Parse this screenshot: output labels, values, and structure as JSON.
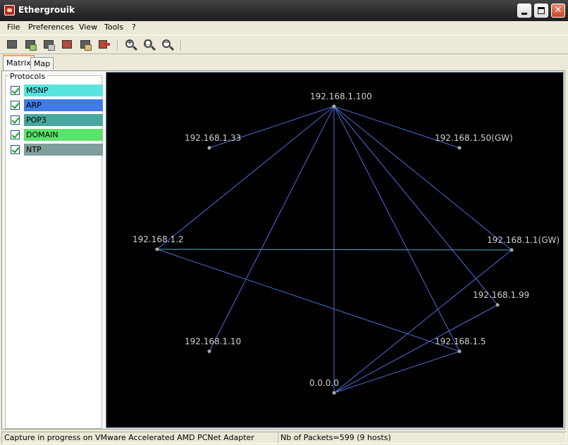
{
  "window": {
    "title": "Ethergrouik"
  },
  "menu": [
    "File",
    "Preferences",
    "View",
    "Tools",
    "?"
  ],
  "toolbar": {
    "buttons": [
      {
        "icon": "capture-device-icon"
      },
      {
        "icon": "capture-start-icon"
      },
      {
        "icon": "capture-stop-icon"
      },
      {
        "icon": "capture-record-icon"
      },
      {
        "icon": "capture-save-icon"
      },
      {
        "icon": "exit-icon"
      },
      {
        "icon": "zoom-in-icon"
      },
      {
        "icon": "zoom-fit-icon"
      },
      {
        "icon": "zoom-out-icon"
      }
    ]
  },
  "tabs": [
    {
      "label": "Matrix",
      "active": true
    },
    {
      "label": "Map",
      "active": false
    }
  ],
  "protocols": {
    "legend": "Protocols",
    "items": [
      {
        "label": "MSNP",
        "checked": true,
        "color": "#5ae3df"
      },
      {
        "label": "ARP",
        "checked": true,
        "color": "#3f7ae6"
      },
      {
        "label": "POP3",
        "checked": true,
        "color": "#47a89d"
      },
      {
        "label": "DOMAIN",
        "checked": true,
        "color": "#5ae36a"
      },
      {
        "label": "NTP",
        "checked": true,
        "color": "#809e9b"
      }
    ]
  },
  "graph": {
    "background": "#000000",
    "edge_color": "#4a6fd6",
    "node_color": "#aaaaaa",
    "label_color": "#cfcfcf",
    "nodes": [
      {
        "id": "192.168.1.100",
        "label": "192.168.1.100"
      },
      {
        "id": "192.168.1.33",
        "label": "192.168.1.33"
      },
      {
        "id": "192.168.1.50",
        "label": "192.168.1.50(GW)"
      },
      {
        "id": "192.168.1.2",
        "label": "192.168.1.2"
      },
      {
        "id": "192.168.1.1",
        "label": "192.168.1.1(GW)"
      },
      {
        "id": "192.168.1.99",
        "label": "192.168.1.99"
      },
      {
        "id": "192.168.1.10",
        "label": "192.168.1.10"
      },
      {
        "id": "192.168.1.5",
        "label": "192.168.1.5"
      },
      {
        "id": "0.0.0.0",
        "label": "0.0.0.0"
      }
    ],
    "edges": [
      [
        "192.168.1.100",
        "192.168.1.33"
      ],
      [
        "192.168.1.100",
        "192.168.1.50"
      ],
      [
        "192.168.1.100",
        "192.168.1.2"
      ],
      [
        "192.168.1.100",
        "192.168.1.10"
      ],
      [
        "192.168.1.100",
        "0.0.0.0"
      ],
      [
        "192.168.1.100",
        "192.168.1.5"
      ],
      [
        "192.168.1.100",
        "192.168.1.99"
      ],
      [
        "192.168.1.100",
        "192.168.1.1"
      ],
      [
        "192.168.1.2",
        "192.168.1.1"
      ],
      [
        "192.168.1.2",
        "192.168.1.5"
      ],
      [
        "0.0.0.0",
        "192.168.1.1"
      ],
      [
        "0.0.0.0",
        "192.168.1.99"
      ],
      [
        "0.0.0.0",
        "192.168.1.5"
      ]
    ]
  },
  "status": {
    "capture": "Capture in progress on  VMware Accelerated AMD PCNet Adapter",
    "packets": "Nb of Packets=599 (9 hosts)"
  }
}
